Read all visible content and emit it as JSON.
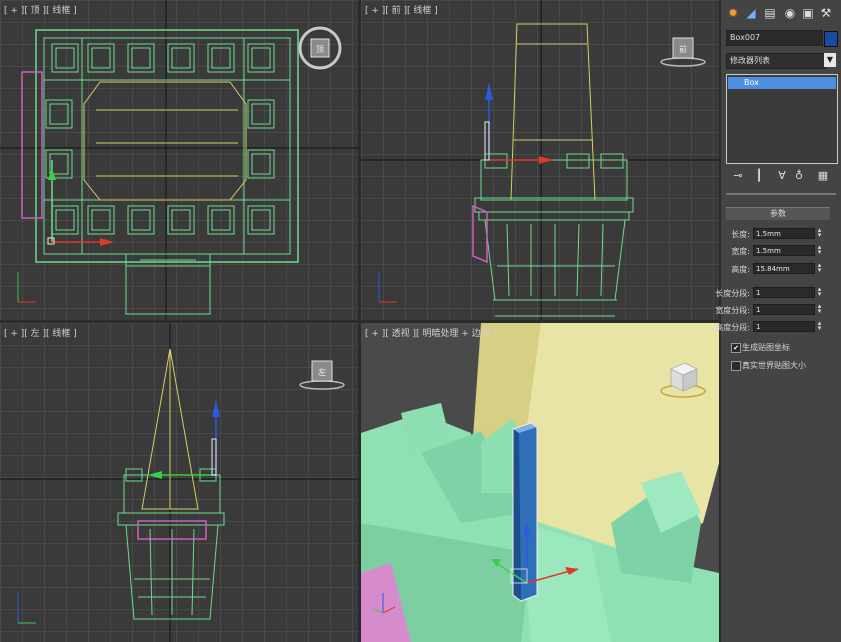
{
  "viewports": {
    "top_label": "[ + ][ 顶 ][ 线框 ]",
    "front_label": "[ + ][ 前 ][ 线框 ]",
    "left_label": "[ + ][ 左 ][ 线框 ]",
    "persp_label": "[ + ][ 透视 ][ 明暗处理 + 边面 ]"
  },
  "panel": {
    "toolbar_icons": [
      "create-icon",
      "modify-icon",
      "hierarchy-icon",
      "motion-icon",
      "display-icon",
      "utilities-icon"
    ],
    "object_name": "Box007",
    "object_color": "#1b4aa3",
    "modifier_list": "修改器列表",
    "stack_items": [
      "Box"
    ],
    "rollout_title": "参数",
    "params": [
      {
        "label": "长度:",
        "value": "1.5mm"
      },
      {
        "label": "宽度:",
        "value": "1.5mm"
      },
      {
        "label": "高度:",
        "value": "15.84mm"
      },
      {
        "label": "长度分段:",
        "value": "1"
      },
      {
        "label": "宽度分段:",
        "value": "1"
      },
      {
        "label": "高度分段:",
        "value": "1"
      }
    ],
    "checkboxes": [
      {
        "label": "生成贴图坐标",
        "checked": true
      },
      {
        "label": "真实世界贴图大小",
        "checked": false
      }
    ]
  }
}
